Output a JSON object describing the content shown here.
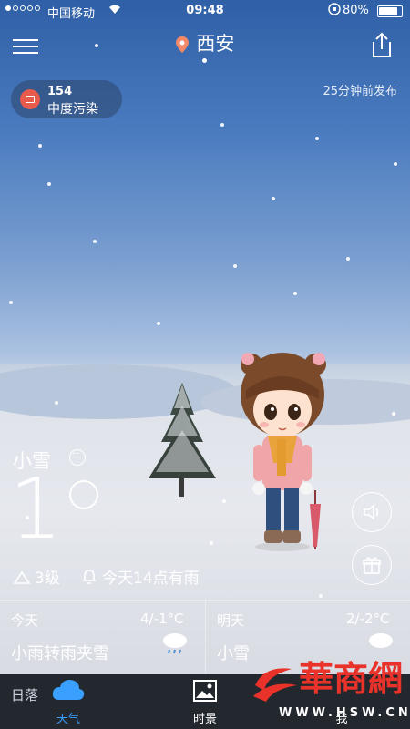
{
  "status_bar": {
    "carrier": "中国移动",
    "time": "09:48",
    "battery": "80%"
  },
  "header": {
    "city": "西安"
  },
  "aqi": {
    "value": "154",
    "level": "中度污染"
  },
  "publish_time": "25分钟前发布",
  "current": {
    "condition": "小雪",
    "temperature": "1",
    "wind": "3级",
    "forecast_note": "今天14点有雨"
  },
  "forecast": {
    "today": {
      "label": "今天",
      "range": "4/-1°C",
      "desc": "小雨转雨夹雪"
    },
    "tomorrow": {
      "label": "明天",
      "range": "2/-2°C",
      "desc": "小雪"
    }
  },
  "bottom": {
    "sunset_label": "日落"
  },
  "tabs": [
    {
      "label": "天气"
    },
    {
      "label": "时景"
    },
    {
      "label": "我"
    }
  ],
  "watermark": {
    "text": "華商網",
    "url": "WWW.HSW.CN"
  },
  "colors": {
    "accent": "#3aa0ff",
    "aqi_badge": "#e85a4b",
    "pin": "#f28a6a"
  }
}
